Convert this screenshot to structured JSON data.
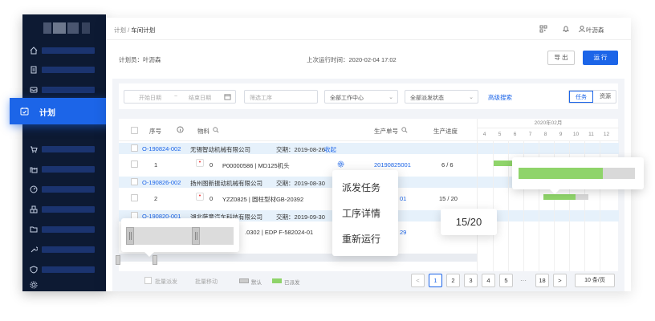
{
  "sidebar": {
    "active_label": "计划",
    "items": [
      "home-icon",
      "document-icon",
      "inbox-icon",
      "clipboard-icon",
      "cart-icon",
      "factory-icon",
      "gauge-icon",
      "boxes-icon",
      "folder-icon",
      "wrench-icon",
      "shield-icon",
      "gear-icon"
    ]
  },
  "header": {
    "breadcrumb_root": "计划",
    "breadcrumb_sep": "/",
    "breadcrumb_current": "车间计划",
    "user_name": "叶沥森"
  },
  "info": {
    "planner": "计划员：叶沥森",
    "last_run": "上次运行时间：2020-02-04 17:02",
    "export_label": "导 出",
    "run_label": "运 行"
  },
  "filters": {
    "start_date": "开始日期",
    "range_sep": "~",
    "end_date": "结束日期",
    "process": "筛选工序",
    "work_center": "全部工作中心",
    "dispatch_status": "全部派发状态",
    "advanced": "高级搜索",
    "view_task": "任务",
    "view_resource": "资源"
  },
  "table": {
    "headers": {
      "seq": "序号",
      "material": "物料",
      "order_no": "生产单号",
      "progress": "生产进度"
    },
    "groups": [
      {
        "order": "O-190824-002",
        "customer": "无锡智动机械有限公司",
        "due": "交期：2019-08-26",
        "action": "收起"
      },
      {
        "order": "O-190826-002",
        "customer": "扬州图新振动机械有限公司",
        "due": "交期：2019-08-30"
      },
      {
        "order": "O-190820-001",
        "customer": "湖北萨意汽车科技有限公司",
        "due": "交期：2019-09-30"
      }
    ],
    "items": [
      {
        "seq": "1",
        "count": "0",
        "material": "P00000586 | MD125机头",
        "order_no": "20190825001",
        "progress": "6 / 6"
      },
      {
        "seq": "2",
        "count": "0",
        "material": "YZZ0825 | 圆柱型材GB-20392",
        "order_no": "01",
        "progress": "15 / 20"
      },
      {
        "material_partial": ".0302 | EDP F-582024-01",
        "order_partial": "29"
      }
    ]
  },
  "gantt": {
    "month": "2020年02月",
    "days": [
      "4",
      "5",
      "6",
      "7",
      "8",
      "9",
      "10",
      "11",
      "12"
    ]
  },
  "footer": {
    "batch_dispatch": "批量派发",
    "batch_move": "批量移动",
    "legend_default": "默认",
    "legend_dispatched": "已派发",
    "legend_default_color": "#cccccc",
    "legend_dispatched_color": "#8fd46a",
    "prev": "<",
    "pages": [
      "1",
      "2",
      "3",
      "4",
      "5"
    ],
    "ellipsis": "···",
    "last_page": "18",
    "next": ">",
    "page_size": "10 条/页"
  },
  "context_menu": {
    "items": [
      "派发任务",
      "工序详情",
      "重新运行"
    ]
  },
  "tooltip_progress": "15/20",
  "colors": {
    "primary": "#1c65e8",
    "sidebar": "#0d1a33",
    "dispatched": "#8fd46a"
  }
}
